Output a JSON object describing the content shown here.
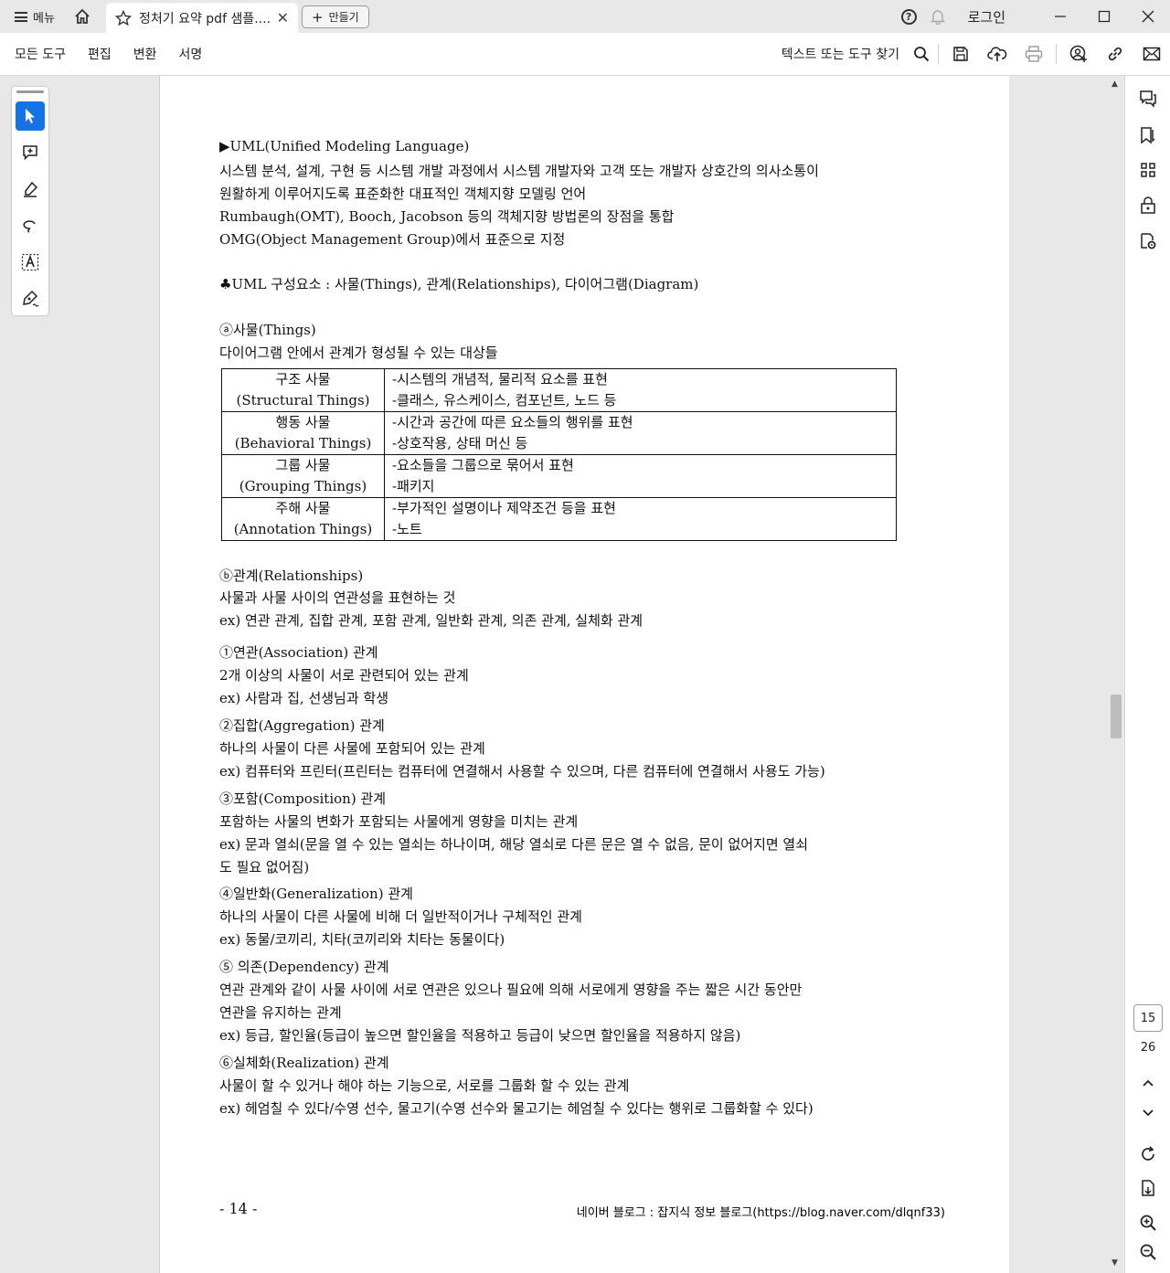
{
  "titlebar": {
    "menu_label": "메뉴",
    "tab_title": "정처기 요약 pdf 샘플....",
    "new_tab_label": "만들기",
    "login_label": "로그인"
  },
  "toolbar": {
    "menus": [
      "모든 도구",
      "편집",
      "변환",
      "서명"
    ],
    "find_tools": "텍스트 또는 도구 찾기"
  },
  "document": {
    "lines": [
      "▶UML(Unified Modeling Language)",
      "시스템 분석, 설계, 구현 등 시스템 개발 과정에서 시스템 개발자와 고객 또는 개발자 상호간의 의사소통이",
      "원활하게 이루어지도록 표준화한 대표적인 객체지향 모델링 언어",
      "Rumbaugh(OMT), Booch, Jacobson 등의 객체지향 방법론의 장점을 통합",
      "OMG(Object Management Group)에서 표준으로 지정",
      "♣UML 구성요소 : 사물(Things), 관계(Relationships), 다이어그램(Diagram)",
      "ⓐ사물(Things)",
      "다이어그램 안에서 관계가 형성될 수 있는 대상들"
    ],
    "table": [
      {
        "name": "구조 사물",
        "eng": "(Structural Things)",
        "d1": "-시스템의 개념적, 물리적 요소를 표현",
        "d2": "-클래스, 유스케이스, 컴포넌트, 노드 등"
      },
      {
        "name": "행동 사물",
        "eng": "(Behavioral Things)",
        "d1": "-시간과 공간에 따른 요소들의 행위를 표현",
        "d2": "-상호작용, 상태 머신 등"
      },
      {
        "name": "그룹 사물",
        "eng": "(Grouping Things)",
        "d1": "-요소들을 그룹으로 묶어서 표현",
        "d2": "-패키지"
      },
      {
        "name": "주해 사물",
        "eng": "(Annotation Things)",
        "d1": "-부가적인 설명이나 제약조건 등을 표현",
        "d2": "-노트"
      }
    ],
    "lines2": [
      "ⓑ관계(Relationships)",
      "사물과 사물 사이의 연관성을 표현하는 것",
      "ex) 연관 관계, 집합 관계, 포함 관계, 일반화 관계, 의존 관계, 실체화 관계",
      "①연관(Association) 관계",
      "2개 이상의 사물이 서로 관련되어 있는 관계",
      "ex) 사람과 집, 선생님과 학생",
      "②집합(Aggregation) 관계",
      "하나의 사물이 다른 사물에 포함되어 있는 관계",
      "ex) 컴퓨터와 프린터(프린터는 컴퓨터에 연결해서 사용할 수 있으며, 다른 컴퓨터에 연결해서 사용도 가능)",
      "③포함(Composition) 관계",
      "포함하는 사물의 변화가 포함되는 사물에게 영향을 미치는 관계",
      "ex) 문과 열쇠(문을 열 수 있는 열쇠는 하나이며, 해당 열쇠로 다른 문은 열 수 없음, 문이 없어지면 열쇠",
      "도 필요 없어짐)",
      "④일반화(Generalization) 관계",
      "하나의 사물이 다른 사물에 비해 더 일반적이거나 구체적인 관계",
      "ex) 동물/코끼리, 치타(코끼리와 치타는 동물이다)",
      "⑤ 의존(Dependency) 관계",
      "연관 관계와 같이 사물 사이에 서로 연관은 있으나 필요에 의해 서로에게 영향을 주는 짧은 시간 동안만",
      "연관을 유지하는 관계",
      "ex) 등급, 할인율(등급이 높으면 할인율을 적용하고 등급이 낮으면 할인율을 적용하지 않음)",
      "⑥실체화(Realization) 관계",
      "사물이 할 수 있거나 해야 하는 기능으로, 서로를 그룹화 할 수 있는 관계",
      "ex) 헤엄칠 수 있다/수영 선수, 물고기(수영 선수와 물고기는 헤엄칠 수 있다는 행위로 그룹화할 수 있다)"
    ],
    "page_number": "- 14 -",
    "footer_source": "네이버 블로그 : 잡지식 정보 블로그(https://blog.naver.com/dlqnf33)"
  },
  "navigation": {
    "current_page": "15",
    "total_pages": "26"
  }
}
